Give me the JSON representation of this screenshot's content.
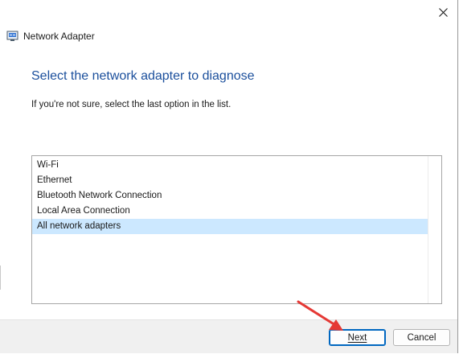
{
  "window": {
    "title": "Network Adapter",
    "close_icon": "close-icon",
    "app_icon": "network-adapter-icon"
  },
  "main": {
    "heading": "Select the network adapter to diagnose",
    "instruction": "If you're not sure, select the last option in the list.",
    "adapters": [
      "Wi-Fi",
      "Ethernet",
      "Bluetooth Network Connection",
      "Local Area Connection",
      "All network adapters"
    ],
    "selected": "All network adapters"
  },
  "footer": {
    "next_label": "Next",
    "cancel_label": "Cancel"
  },
  "annotation": {
    "arrow_color": "#e53935",
    "arrow_icon": "red-pointer-arrow-icon"
  },
  "colors": {
    "heading": "#1b4f9c",
    "selection": "#cce8ff",
    "accent": "#0067c0"
  }
}
